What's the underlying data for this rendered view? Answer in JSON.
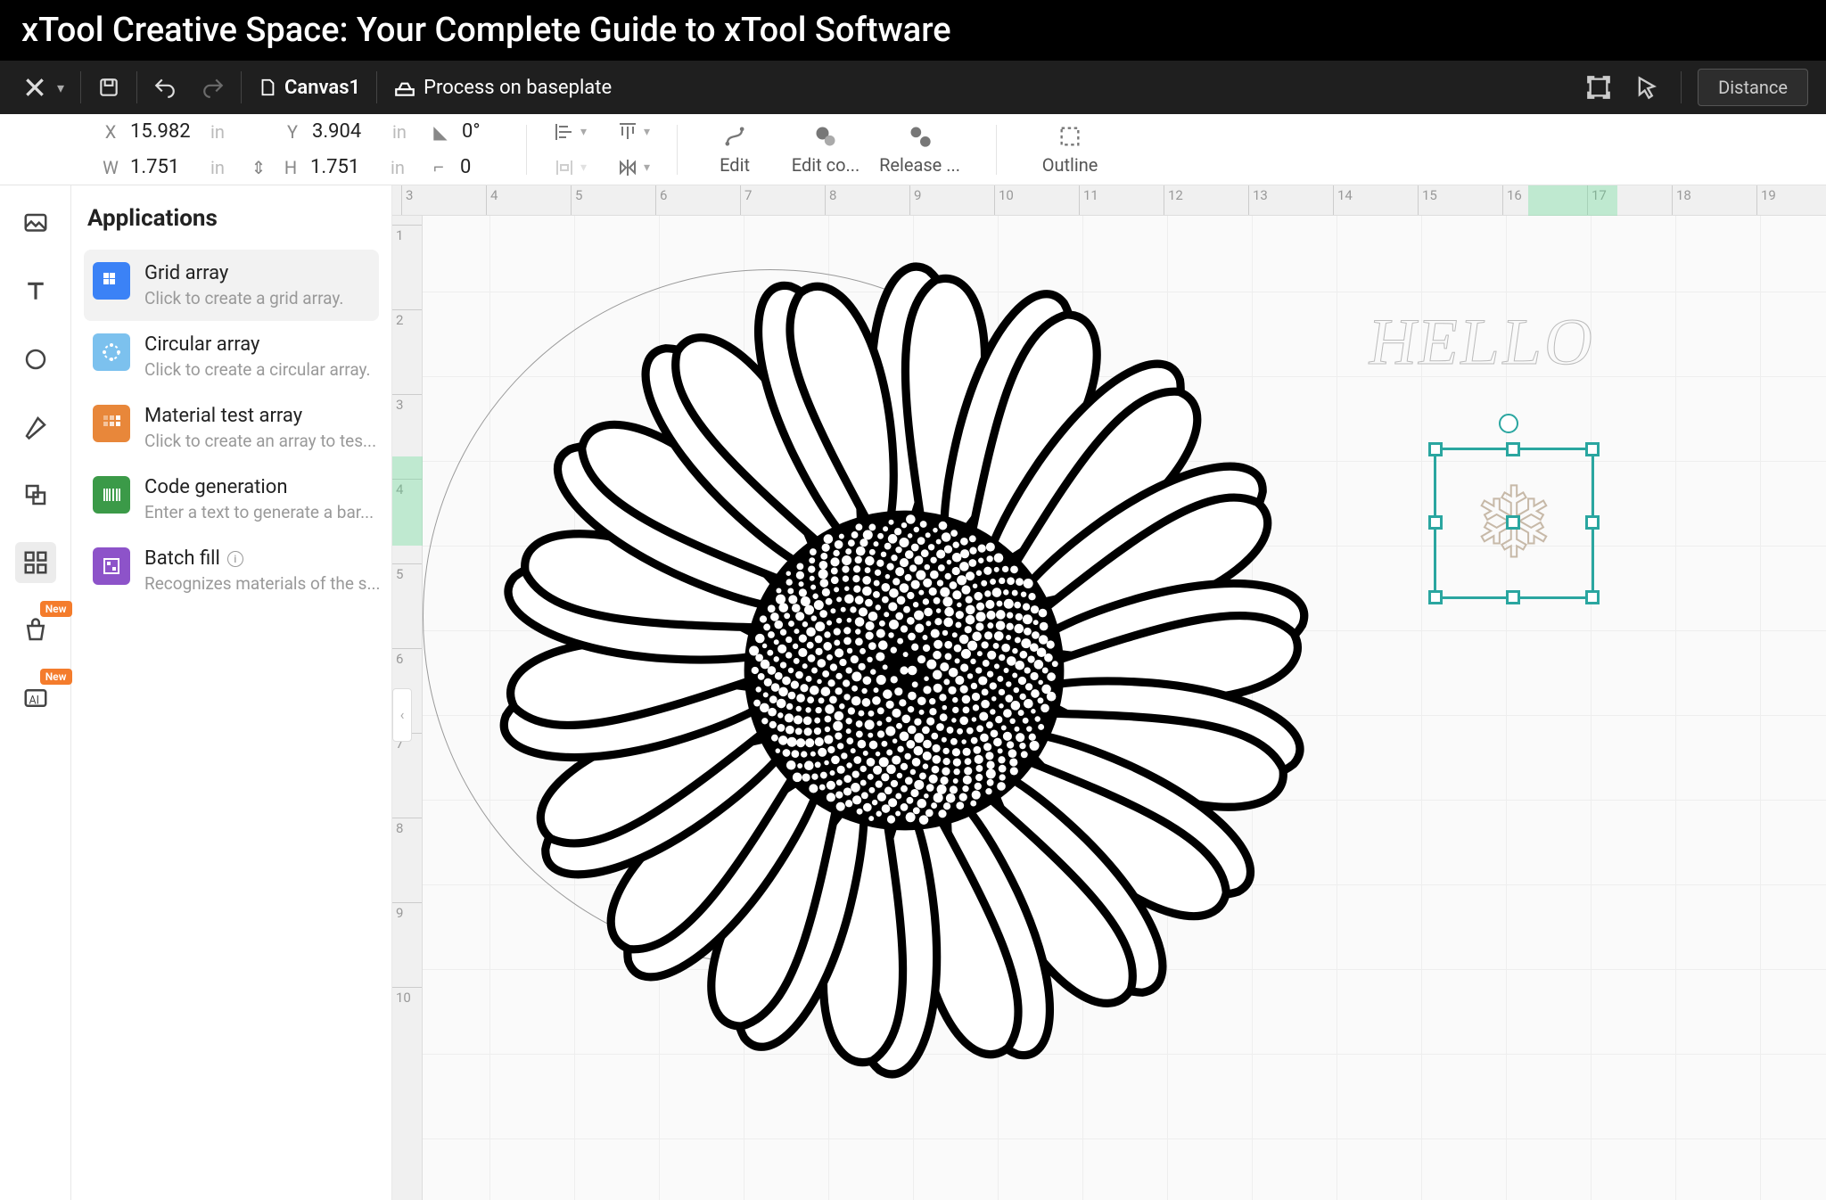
{
  "title": "xTool Creative Space: Your Complete Guide to xTool Software",
  "toolbar": {
    "tab": "Canvas1",
    "process": "Process on baseplate",
    "distance": "Distance"
  },
  "properties": {
    "x_label": "X",
    "x_value": "15.982",
    "x_unit": "in",
    "y_label": "Y",
    "y_value": "3.904",
    "y_unit": "in",
    "rot_label": "↺",
    "rot_value": "0°",
    "w_label": "W",
    "w_value": "1.751",
    "w_unit": "in",
    "h_label": "H",
    "h_value": "1.751",
    "h_unit": "in",
    "corner_label": "⌐",
    "corner_value": "0",
    "actions": {
      "edit": "Edit",
      "editco": "Edit co...",
      "release": "Release ...",
      "outline": "Outline"
    }
  },
  "rail": {
    "new_badge": "New"
  },
  "panel": {
    "title": "Applications",
    "items": [
      {
        "title": "Grid array",
        "sub": "Click to create a grid array."
      },
      {
        "title": "Circular array",
        "sub": "Click to create a circular array."
      },
      {
        "title": "Material test array",
        "sub": "Click to create an array to tes..."
      },
      {
        "title": "Code generation",
        "sub": "Enter a text to generate a bar..."
      },
      {
        "title": "Batch fill",
        "sub": "Recognizes materials of the s..."
      }
    ]
  },
  "canvas": {
    "ruler_h": [
      "3",
      "4",
      "5",
      "6",
      "7",
      "8",
      "9",
      "10",
      "11",
      "12",
      "13",
      "14",
      "15",
      "16",
      "17",
      "18",
      "19"
    ],
    "ruler_v": [
      "1",
      "2",
      "3",
      "4",
      "5",
      "6",
      "7",
      "8",
      "9",
      "10"
    ],
    "hello_text": "HELLO"
  }
}
